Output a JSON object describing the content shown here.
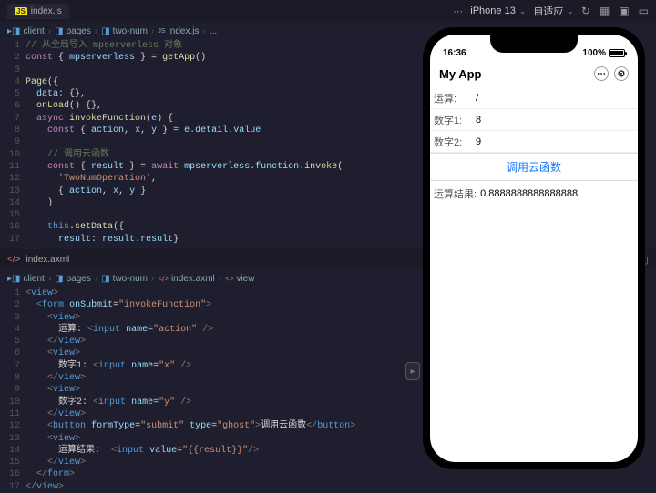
{
  "topbar": {
    "tab_icon_label": "JS",
    "tab_title": "index.js",
    "device": "iPhone 13",
    "fit": "自适应"
  },
  "breadcrumb1": {
    "segs": [
      "client",
      "pages",
      "two-num",
      "index.js",
      "..."
    ],
    "icons": [
      "folder",
      "folder",
      "folder",
      "js",
      "ellipsis"
    ]
  },
  "code1": {
    "lines": [
      {
        "n": 1,
        "html": "<span class='c-comment'>// 从全局导入 mpserverless 对象</span>"
      },
      {
        "n": 2,
        "html": "<span class='c-kw'>const</span> { <span class='c-prop'>mpserverless</span> } = <span class='c-fn'>getApp</span>()"
      },
      {
        "n": 3,
        "html": ""
      },
      {
        "n": 4,
        "html": "<span class='c-fn'>Page</span>({"
      },
      {
        "n": 5,
        "html": "  <span class='c-prop'>data</span>: {},"
      },
      {
        "n": 6,
        "html": "  <span class='c-fn'>onLoad</span>() {},"
      },
      {
        "n": 7,
        "html": "  <span class='c-kw'>async</span> <span class='c-fn'>invokeFunction</span>(<span class='c-prop'>e</span>) {"
      },
      {
        "n": 8,
        "html": "    <span class='c-kw'>const</span> { <span class='c-prop'>action</span>, <span class='c-prop'>x</span>, <span class='c-prop'>y</span> } = <span class='c-prop'>e</span>.<span class='c-prop'>detail</span>.<span class='c-prop'>value</span>"
      },
      {
        "n": 9,
        "html": ""
      },
      {
        "n": 10,
        "html": "    <span class='c-comment'>// 调用云函数</span>"
      },
      {
        "n": 11,
        "html": "    <span class='c-kw'>const</span> { <span class='c-prop'>result</span> } = <span class='c-kw'>await</span> <span class='c-prop'>mpserverless</span>.<span class='c-prop'>function</span>.<span class='c-fn'>invoke</span>("
      },
      {
        "n": 12,
        "html": "      <span class='c-str'>'TwoNumOperation'</span>,"
      },
      {
        "n": 13,
        "html": "      { <span class='c-prop'>action</span>, <span class='c-prop'>x</span>, <span class='c-prop'>y</span> }"
      },
      {
        "n": 14,
        "html": "    )"
      },
      {
        "n": 15,
        "html": ""
      },
      {
        "n": 16,
        "html": "    <span class='c-const'>this</span>.<span class='c-fn'>setData</span>({"
      },
      {
        "n": 17,
        "html": "      <span class='c-prop'>result</span>: <span class='c-prop'>result</span>.<span class='c-prop'>result</span>}"
      }
    ]
  },
  "pane2_tab": "index.axml",
  "breadcrumb2": {
    "segs": [
      "client",
      "pages",
      "two-num",
      "index.axml",
      "view"
    ]
  },
  "code2": {
    "lines": [
      {
        "n": 1,
        "html": "<span class='c-brkt'>&lt;</span><span class='c-tag'>view</span><span class='c-brkt'>&gt;</span>"
      },
      {
        "n": 2,
        "html": "  <span class='c-brkt'>&lt;</span><span class='c-tag'>form</span> <span class='c-attr'>onSubmit</span>=<span class='c-str'>\"invokeFunction\"</span><span class='c-brkt'>&gt;</span>"
      },
      {
        "n": 3,
        "html": "    <span class='c-brkt'>&lt;</span><span class='c-tag'>view</span><span class='c-brkt'>&gt;</span>"
      },
      {
        "n": 4,
        "html": "      运算: <span class='c-brkt'>&lt;</span><span class='c-tag'>input</span> <span class='c-attr'>name</span>=<span class='c-str'>\"action\"</span> <span class='c-brkt'>/&gt;</span>"
      },
      {
        "n": 5,
        "html": "    <span class='c-brkt'>&lt;/</span><span class='c-tag'>view</span><span class='c-brkt'>&gt;</span>"
      },
      {
        "n": 6,
        "html": "    <span class='c-brkt'>&lt;</span><span class='c-tag'>view</span><span class='c-brkt'>&gt;</span>"
      },
      {
        "n": 7,
        "html": "      数字1: <span class='c-brkt'>&lt;</span><span class='c-tag'>input</span> <span class='c-attr'>name</span>=<span class='c-str'>\"x\"</span> <span class='c-brkt'>/&gt;</span>"
      },
      {
        "n": 8,
        "html": "    <span class='c-brkt'>&lt;/</span><span class='c-tag'>view</span><span class='c-brkt'>&gt;</span>"
      },
      {
        "n": 9,
        "html": "    <span class='c-brkt'>&lt;</span><span class='c-tag'>view</span><span class='c-brkt'>&gt;</span>"
      },
      {
        "n": 10,
        "html": "      数字2: <span class='c-brkt'>&lt;</span><span class='c-tag'>input</span> <span class='c-attr'>name</span>=<span class='c-str'>\"y\"</span> <span class='c-brkt'>/&gt;</span>"
      },
      {
        "n": 11,
        "html": "    <span class='c-brkt'>&lt;/</span><span class='c-tag'>view</span><span class='c-brkt'>&gt;</span>"
      },
      {
        "n": 12,
        "html": "    <span class='c-brkt'>&lt;</span><span class='c-tag'>button</span> <span class='c-attr'>formType</span>=<span class='c-str'>\"submit\"</span> <span class='c-attr'>type</span>=<span class='c-str'>\"ghost\"</span><span class='c-brkt'>&gt;</span>调用云函数<span class='c-brkt'>&lt;/</span><span class='c-tag'>button</span><span class='c-brkt'>&gt;</span>"
      },
      {
        "n": 13,
        "html": "    <span class='c-brkt'>&lt;</span><span class='c-tag'>view</span><span class='c-brkt'>&gt;</span>"
      },
      {
        "n": 14,
        "html": "      运算结果:  <span class='c-brkt'>&lt;</span><span class='c-tag'>input</span> <span class='c-attr'>value</span>=<span class='c-str'>\"{{result}}\"</span><span class='c-brkt'>/&gt;</span>"
      },
      {
        "n": 15,
        "html": "    <span class='c-brkt'>&lt;/</span><span class='c-tag'>view</span><span class='c-brkt'>&gt;</span>"
      },
      {
        "n": 16,
        "html": "  <span class='c-brkt'>&lt;/</span><span class='c-tag'>form</span><span class='c-brkt'>&gt;</span>"
      },
      {
        "n": 17,
        "html": "<span class='c-brkt'>&lt;/</span><span class='c-tag'>view</span><span class='c-brkt'>&gt;</span>"
      }
    ]
  },
  "phone": {
    "time": "16:36",
    "battery_pct": "100%",
    "app_title": "My App",
    "row_op_label": "运算:",
    "row_op_value": "/",
    "row_x_label": "数字1:",
    "row_x_value": "8",
    "row_y_label": "数字2:",
    "row_y_value": "9",
    "btn_label": "调用云函数",
    "result_label": "运算结果:",
    "result_value": "0.8888888888888888"
  }
}
